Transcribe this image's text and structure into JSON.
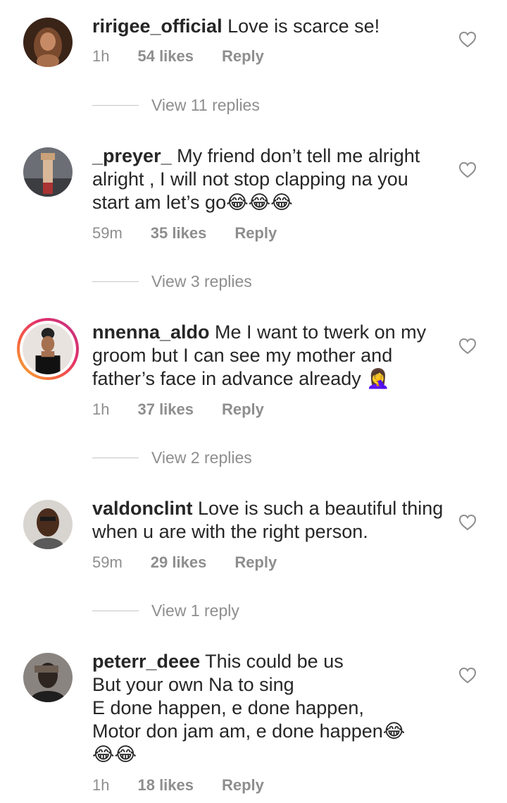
{
  "comments": [
    {
      "username": "ririgee_official",
      "text": "Love is scarce se!",
      "time": "1h",
      "likes": "54 likes",
      "reply": "Reply",
      "view_replies": "View 11 replies"
    },
    {
      "username": "_preyer_",
      "text": "My friend don’t tell me alright alright , I will not stop clapping na you start am let’s go😂😂😂",
      "time": "59m",
      "likes": "35 likes",
      "reply": "Reply",
      "view_replies": "View 3 replies"
    },
    {
      "username": "nnenna_aldo",
      "text": "Me I want to twerk on my groom but I can see my mother and father’s face in advance already 🤦‍♀️",
      "time": "1h",
      "likes": "37 likes",
      "reply": "Reply",
      "view_replies": "View 2 replies"
    },
    {
      "username": "valdonclint",
      "text": "Love is such a beautiful thing when u are with the right person.",
      "time": "59m",
      "likes": "29 likes",
      "reply": "Reply",
      "view_replies": "View 1 reply"
    },
    {
      "username": "peterr_deee",
      "text_lines": [
        "This could be us",
        "But your own Na to sing",
        "E done happen, e done happen,",
        "Motor don jam am, e done happen😂",
        "😂😂"
      ],
      "time": "1h",
      "likes": "18 likes",
      "reply": "Reply"
    }
  ],
  "colors": {
    "text": "#262626",
    "secondary": "#8e8e8e",
    "divider": "#c7c7c7"
  },
  "icons": {
    "like": "heart-outline-icon"
  }
}
